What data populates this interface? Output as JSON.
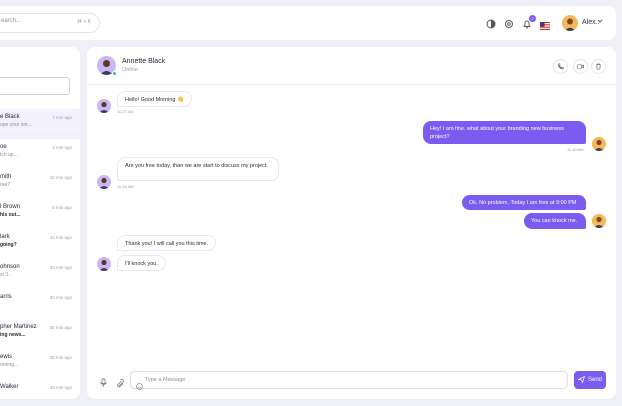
{
  "topbar": {
    "search_placeholder": "earch...",
    "search_shortcut": "⌘ + K",
    "notification_count": "2",
    "user_name": "Alex.."
  },
  "sidebar": {
    "contacts": [
      {
        "name": "e Black",
        "message": "ope your sm...",
        "time": "7 min ago",
        "active": true,
        "bold": false
      },
      {
        "name": "oe",
        "message": "tch up...",
        "time": "2 min ago",
        "active": false,
        "bold": false
      },
      {
        "name": "mith",
        "message": "ree?",
        "time": "10 min ago",
        "active": false,
        "bold": false
      },
      {
        "name": "l Brown",
        "message": "his out...",
        "time": "5 min ago",
        "active": false,
        "bold": true
      },
      {
        "name": "lark",
        "message": "going?",
        "time": "15 min ago",
        "active": false,
        "bold": true
      },
      {
        "name": "ohnson",
        "message": "st 3...",
        "time": "20 min ago",
        "active": false,
        "bold": false
      },
      {
        "name": "arris",
        "message": "",
        "time": "30 min ago",
        "active": false,
        "bold": false
      },
      {
        "name": "pher Martinez",
        "message": "ing news...",
        "time": "35 min ago",
        "active": false,
        "bold": true
      },
      {
        "name": "ewis",
        "message": "orning...",
        "time": "35 min ago",
        "active": false,
        "bold": false
      },
      {
        "name": "Walker",
        "message": "",
        "time": "40 min ago",
        "active": false,
        "bold": false
      }
    ]
  },
  "chat": {
    "contact_name": "Annette Black",
    "contact_status": "Online",
    "messages": [
      {
        "text": "Hello! Good Morning 👋",
        "time": "11:27 AM"
      },
      {
        "text": "Hey! I am fine. what about your branding new business project?",
        "time": "11:30 AM"
      },
      {
        "text": "Are you free today, than we are start to discuss my project.",
        "time": "11:35 AM"
      },
      {
        "text": "Ok, No problem, Today I am free at 9:00 PM",
        "time": ""
      },
      {
        "text": "You can knock me.",
        "time": ""
      },
      {
        "text": "Thank you! I will call you this time.",
        "time": ""
      },
      {
        "text": "I'll knock you.",
        "time": ""
      }
    ],
    "input_placeholder": "Type a Message",
    "send_label": "Send"
  },
  "colors": {
    "accent": "#7b5cf0",
    "background": "#eef0f5",
    "online": "#2ecc71"
  },
  "icons": [
    "theme-icon",
    "settings-icon",
    "bell-icon",
    "us-flag-icon",
    "phone-icon",
    "video-icon",
    "trash-icon",
    "mic-icon",
    "paperclip-icon",
    "smile-icon",
    "send-icon"
  ]
}
